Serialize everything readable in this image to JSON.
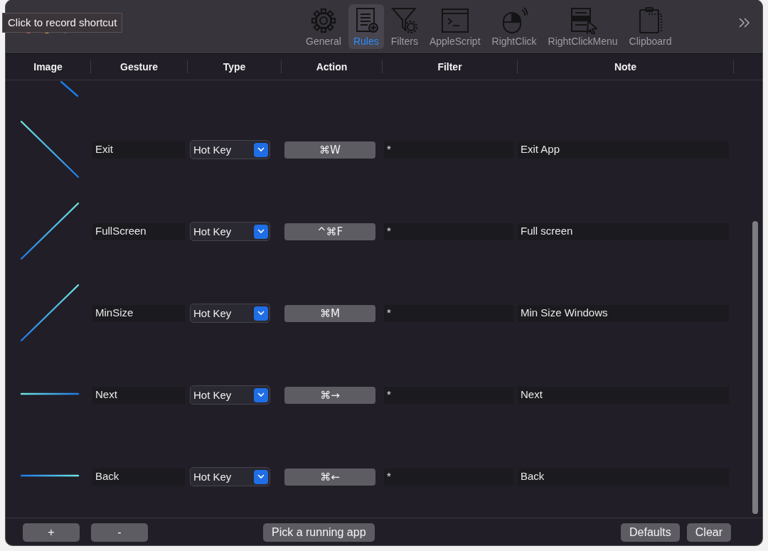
{
  "tooltip": "Click to record shortcut",
  "toolbar": [
    {
      "label": "General",
      "kind": "gear",
      "selected": false
    },
    {
      "label": "Rules",
      "kind": "list",
      "selected": true
    },
    {
      "label": "Filters",
      "kind": "funnel",
      "selected": false
    },
    {
      "label": "AppleScript",
      "kind": "terminal",
      "selected": false
    },
    {
      "label": "RightClick",
      "kind": "mouse",
      "selected": false
    },
    {
      "label": "RightClickMenu",
      "kind": "menu",
      "selected": false
    },
    {
      "label": "Clipboard",
      "kind": "clipboard",
      "selected": false
    }
  ],
  "table": {
    "columns": [
      "Image",
      "Gesture",
      "Type",
      "Action",
      "Filter",
      "Note"
    ],
    "rows": [
      {
        "kind": "down",
        "gesture": "Exit",
        "type": "Hot Key",
        "action": "⌘W",
        "filter": "*",
        "note": "Exit App"
      },
      {
        "kind": "up",
        "gesture": "FullScreen",
        "type": "Hot Key",
        "action": "^⌘F",
        "filter": "*",
        "note": "Full screen"
      },
      {
        "kind": "up",
        "gesture": "MinSize",
        "type": "Hot Key",
        "action": "⌘M",
        "filter": "*",
        "note": "Min Size Windows"
      },
      {
        "kind": "right",
        "gesture": "Next",
        "type": "Hot Key",
        "action": "⌘→",
        "filter": "*",
        "note": "Next"
      },
      {
        "kind": "left",
        "gesture": "Back",
        "type": "Hot Key",
        "action": "⌘←",
        "filter": "*",
        "note": "Back"
      }
    ]
  },
  "footer": {
    "left_buttons": [
      "+",
      "-"
    ],
    "center_button": "Pick a running app",
    "right_buttons": [
      "Defaults",
      "Clear"
    ]
  }
}
